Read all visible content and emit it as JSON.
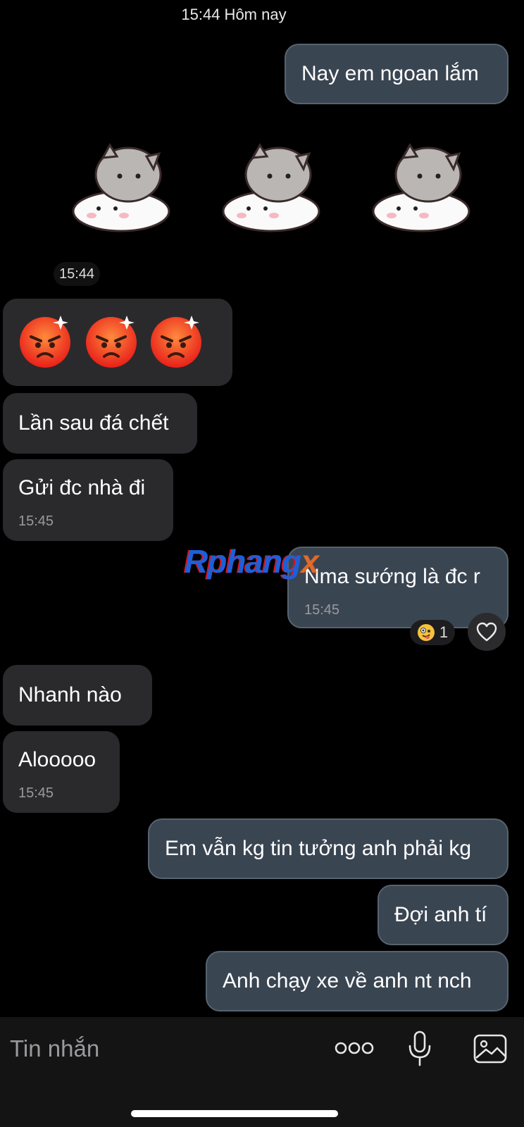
{
  "header": {
    "date_label": "15:44 Hôm nay"
  },
  "messages": {
    "m1": {
      "text": "Nay em ngoan lắm"
    },
    "sticker_time": "15:44",
    "m2": {
      "text": "Lần sau đá chết"
    },
    "m3": {
      "text": "Gửi đc nhà đi",
      "time": "15:45"
    },
    "m4": {
      "text": "Nma sướng là đc r",
      "time": "15:45",
      "reaction_count": "1"
    },
    "m5": {
      "text": "Nhanh nào"
    },
    "m6": {
      "text": "Alooooo",
      "time": "15:45"
    },
    "m7": {
      "text": "Em vẫn kg tin tưởng anh phải kg"
    },
    "m8": {
      "text": "Đợi anh tí"
    },
    "m9": {
      "text": "Anh chạy xe về anh nt nch"
    }
  },
  "watermark": {
    "part1": "Rphang",
    "part2": "x"
  },
  "composer": {
    "placeholder": "Tin nhắn",
    "icons": [
      "more-icon",
      "microphone-icon",
      "image-icon"
    ]
  },
  "colors": {
    "incoming_bubble": "#2a2a2c",
    "outgoing_bubble": "#3a4552",
    "outgoing_border": "#56636f",
    "background": "#000000"
  }
}
